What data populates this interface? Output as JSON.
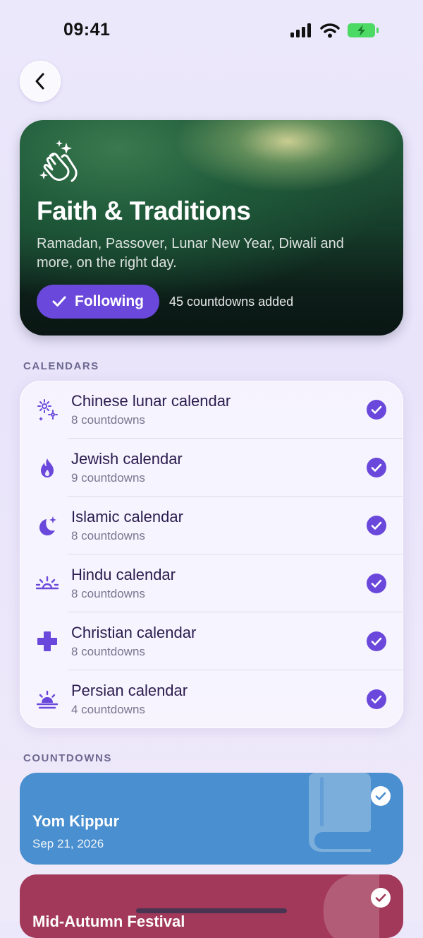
{
  "status": {
    "time": "09:41"
  },
  "hero": {
    "title": "Faith & Traditions",
    "subtitle": "Ramadan, Passover, Lunar New Year, Diwali and more, on the right day.",
    "follow_label": "Following",
    "count_text": "45 countdowns added"
  },
  "calendars_label": "CALENDARS",
  "calendars": [
    {
      "name": "Chinese lunar calendar",
      "count": "8 countdowns",
      "icon": "fireworks-icon"
    },
    {
      "name": "Jewish calendar",
      "count": "9 countdowns",
      "icon": "flame-icon"
    },
    {
      "name": "Islamic calendar",
      "count": "8 countdowns",
      "icon": "crescent-moon-icon"
    },
    {
      "name": "Hindu calendar",
      "count": "8 countdowns",
      "icon": "sunrise-icon"
    },
    {
      "name": "Christian calendar",
      "count": "8 countdowns",
      "icon": "cross-icon"
    },
    {
      "name": "Persian calendar",
      "count": "4 countdowns",
      "icon": "sunset-icon"
    }
  ],
  "countdowns_label": "COUNTDOWNS",
  "countdowns": [
    {
      "title": "Yom Kippur",
      "date": "Sep 21, 2026",
      "color": "#4a8fcf",
      "icon": "book-icon"
    },
    {
      "title": "Mid-Autumn Festival",
      "date": "",
      "color": "#a3395a",
      "icon": "moon-icon"
    }
  ],
  "colors": {
    "accent": "#6a48db",
    "background": "#ece8fb"
  }
}
